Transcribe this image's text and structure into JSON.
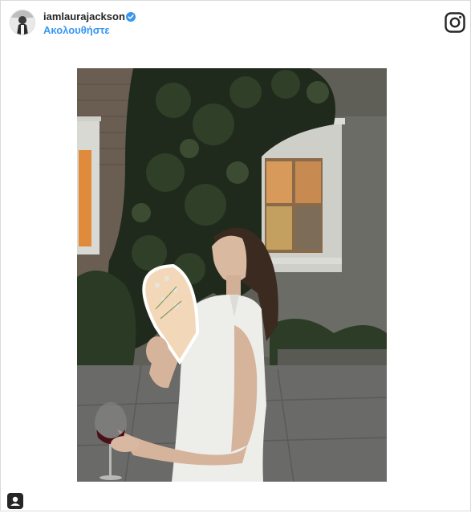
{
  "header": {
    "username": "iamlaurajаckson",
    "verified_icon": "verified-badge-icon",
    "follow_label": "Ακολουθήστε",
    "logo_icon": "instagram-icon"
  },
  "colors": {
    "follow_blue": "#3897f0",
    "verified_blue": "#3897f0",
    "text_dark": "#262626"
  },
  "post": {
    "image_icon": "post-photo"
  },
  "footer": {
    "icon": "user-tag-icon"
  }
}
